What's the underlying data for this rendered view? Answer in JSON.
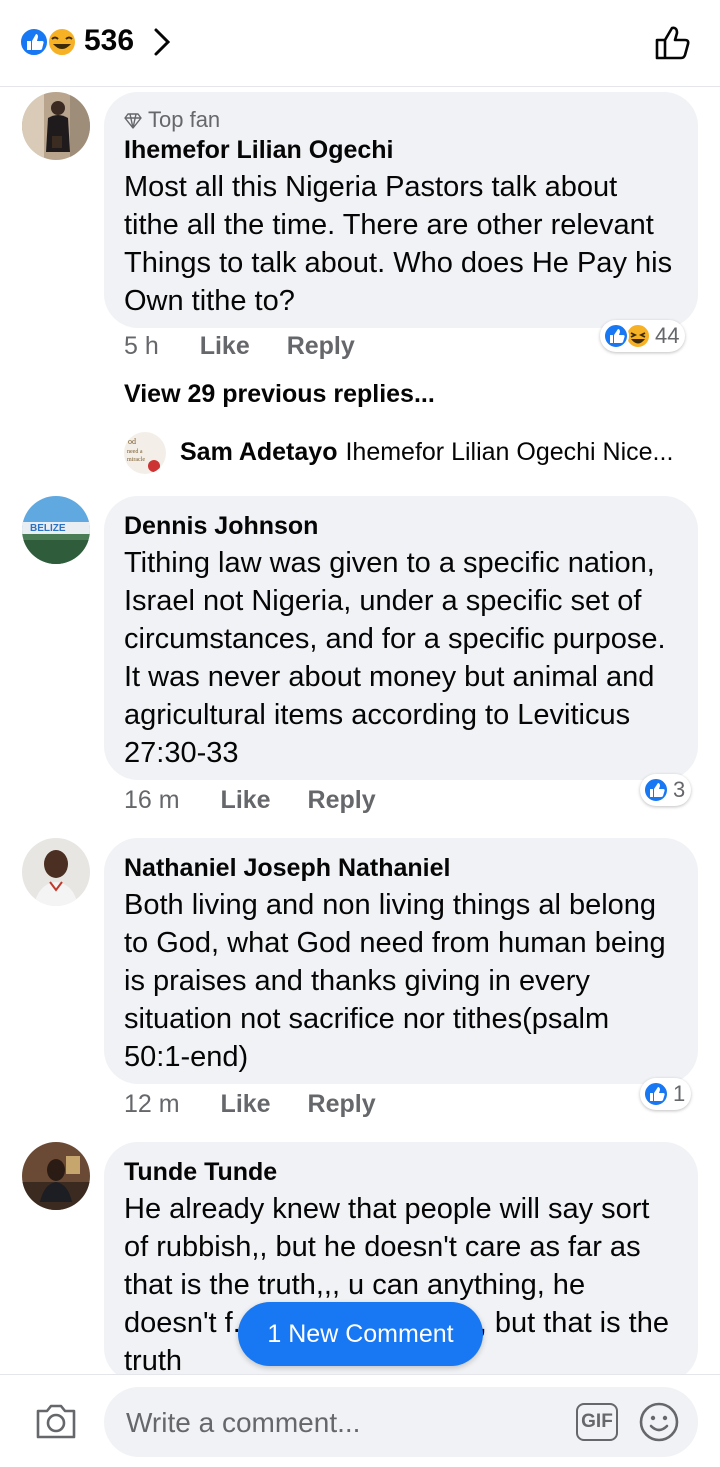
{
  "header": {
    "reaction_count": "536"
  },
  "comments": [
    {
      "badge": "Top fan",
      "name": "Ihemefor Lilian Ogechi",
      "text": "Most all this Nigeria Pastors talk about tithe  all the time. There are other relevant Things to talk about. Who does He Pay his Own tithe to?",
      "time": "5 h",
      "like": "Like",
      "reply": "Reply",
      "reaction_count": "44",
      "reactions": [
        "like-icon",
        "haha-icon"
      ]
    },
    {
      "name": "Dennis Johnson",
      "text": "Tithing law was given to a specific nation, Israel not Nigeria, under a specific set of circumstances, and for a specific purpose. It was never about money but animal and agricultural items according to Leviticus 27:30-33",
      "time": "16 m",
      "like": "Like",
      "reply": "Reply",
      "reaction_count": "3",
      "reactions": [
        "like-icon"
      ],
      "avatar_text": "BELIZE"
    },
    {
      "name": "Nathaniel Joseph Nathaniel",
      "text": "Both living and non living things al belong to God, what God need from human being is praises  and thanks giving in every situation not sacrifice nor tithes(psalm 50:1-end)",
      "time": "12 m",
      "like": "Like",
      "reply": "Reply",
      "reaction_count": "1",
      "reactions": [
        "like-icon"
      ]
    },
    {
      "name": "Tunde Tunde",
      "text": "He already knew that people will say sort of rubbish,, but he doesn't care as far as that is the truth,,, u can anything, he doesn't f... members to pay,, but that is the truth"
    }
  ],
  "view_previous": "View 29 previous replies...",
  "reply_preview": {
    "name": "Sam Adetayo",
    "text": "Ihemefor Lilian Ogechi Nice..."
  },
  "new_comment_label": "1 New Comment",
  "composer": {
    "placeholder": "Write a comment...",
    "gif_label": "GIF"
  },
  "colors": {
    "accent": "#1877f2",
    "bubble": "#f0f2f5",
    "meta_text": "#65676b"
  }
}
